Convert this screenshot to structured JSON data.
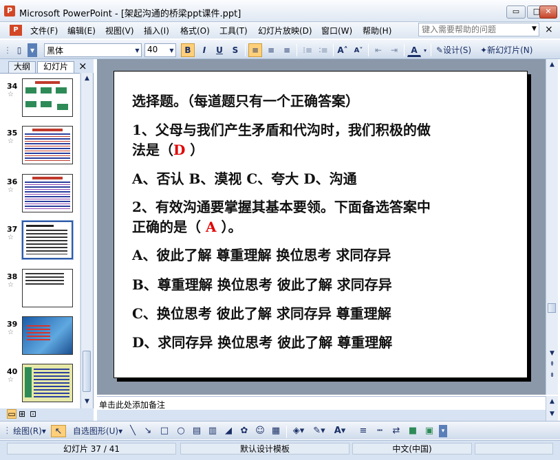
{
  "window": {
    "title": "Microsoft PowerPoint - [架起沟通的桥梁ppt课件.ppt]",
    "min": "▭",
    "max": "□",
    "close": "✕",
    "doc_close": "×"
  },
  "menu": {
    "items": [
      "文件(F)",
      "编辑(E)",
      "视图(V)",
      "插入(I)",
      "格式(O)",
      "工具(T)",
      "幻灯片放映(D)",
      "窗口(W)",
      "帮助(H)"
    ],
    "help_placeholder": "键入需要帮助的问题"
  },
  "formatting": {
    "font": "黑体",
    "size": "40",
    "bold": "B",
    "italic": "I",
    "underline": "U",
    "shadow": "S",
    "design": "设计(S)",
    "new_slide": "新幻灯片(N)"
  },
  "pane": {
    "tab_outline": "大纲",
    "tab_slides": "幻灯片",
    "close": "×"
  },
  "thumbnails": [
    {
      "num": "34",
      "star": "☆"
    },
    {
      "num": "35",
      "star": "☆"
    },
    {
      "num": "36",
      "star": "☆"
    },
    {
      "num": "37",
      "star": "☆"
    },
    {
      "num": "38",
      "star": "☆"
    },
    {
      "num": "39",
      "star": "☆"
    },
    {
      "num": "40",
      "star": "☆"
    }
  ],
  "slide": {
    "line1": "选择题。（每道题只有一个正确答案）",
    "line2": "1、父母与我们产生矛盾和代沟时，我们积极的做",
    "line3a": "法是（",
    "line3ans": "D",
    "line3b": "  ）",
    "line4": "A、否认   B、漠视   C、夸大  D、沟通",
    "line5": "2、有效沟通要掌握其基本要领。下面备选答案中",
    "line6a": "正确的是（  ",
    "line6ans": "A",
    "line6b": "  ）。",
    "line7": "A、彼此了解  尊重理解   换位思考  求同存异",
    "line8": "B、尊重理解  换位思考   彼此了解  求同存异",
    "line9": "C、换位思考  彼此了解   求同存异  尊重理解",
    "line10": "D、求同存异  换位思考   彼此了解  尊重理解"
  },
  "notes": {
    "placeholder": "单击此处添加备注"
  },
  "drawing": {
    "draw": "绘图(R)",
    "autoshapes": "自选图形(U)"
  },
  "status": {
    "slide": "幻灯片 37 / 41",
    "template": "默认设计模板",
    "language": "中文(中国)"
  }
}
